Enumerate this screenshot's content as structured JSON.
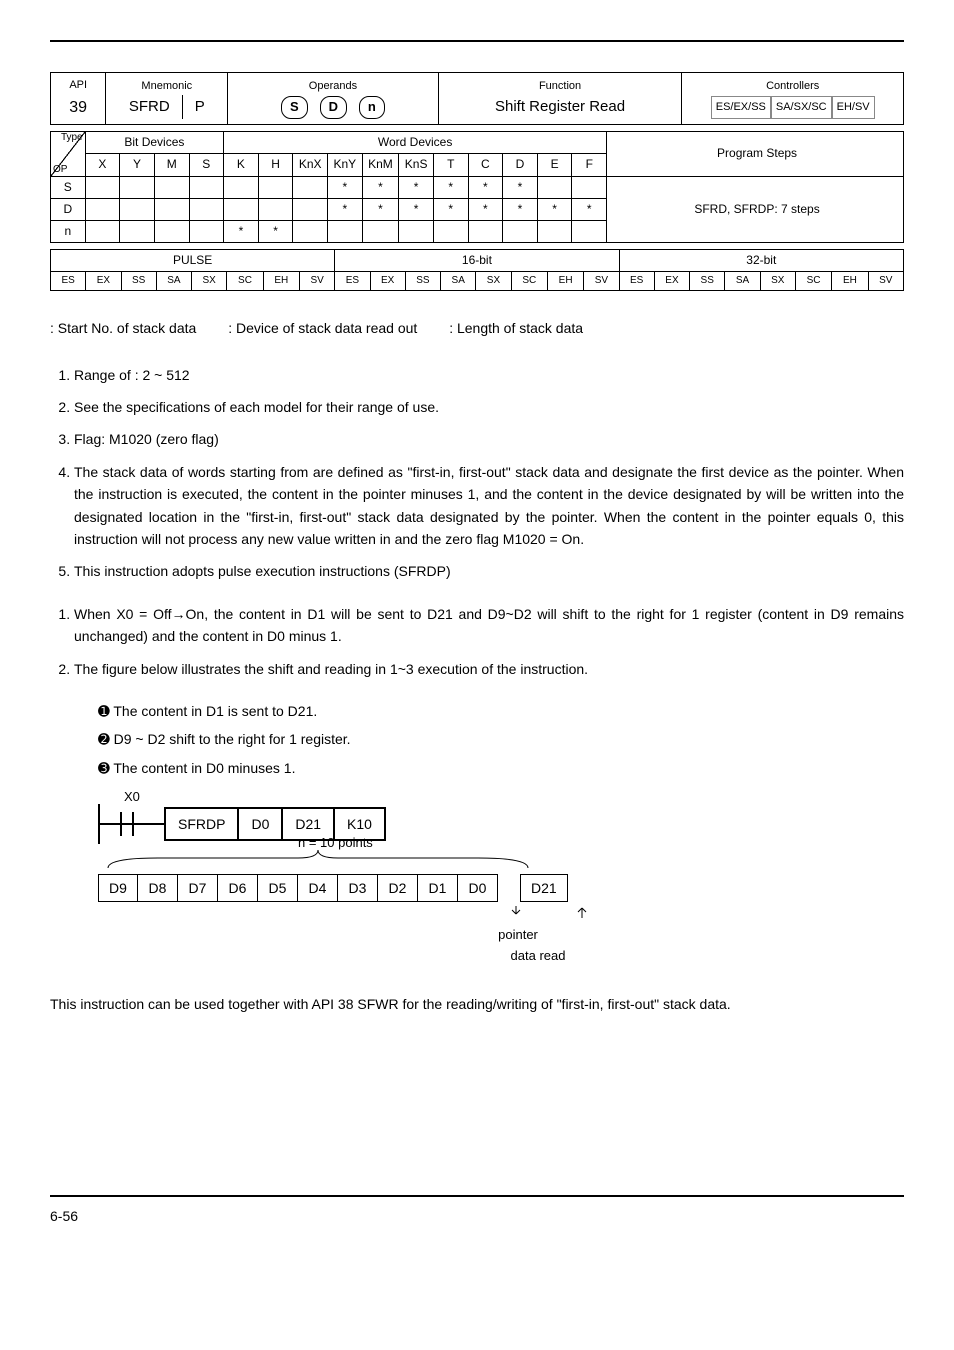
{
  "api": {
    "number": "39",
    "mnemonic": "SFRD",
    "p": "P",
    "operands_s": "S",
    "operands_d": "D",
    "operands_n": "n",
    "function": "Shift Register Read",
    "controllers": [
      "ES/EX/SS",
      "SA/SX/SC",
      "EH/SV"
    ],
    "type_label": "Type",
    "op_label": "OP",
    "cols": [
      "X",
      "Y",
      "M",
      "S",
      "K",
      "H",
      "KnX",
      "KnY",
      "KnM",
      "KnS",
      "T",
      "C",
      "D",
      "E",
      "F"
    ],
    "rows": [
      "S",
      "D",
      "n"
    ],
    "stars": {
      "S": [
        "",
        "",
        "",
        "",
        "",
        "",
        "",
        "*",
        "*",
        "*",
        "*",
        "*",
        "*",
        "",
        ""
      ],
      "D": [
        "",
        "",
        "",
        "",
        "",
        "",
        "",
        "*",
        "*",
        "*",
        "*",
        "*",
        "*",
        "*",
        "*"
      ],
      "n": [
        "",
        "",
        "",
        "",
        "*",
        "*",
        "",
        "",
        "",
        "",
        "",
        "",
        "",
        "",
        ""
      ]
    },
    "steps": "SFRD, SFRDP: 7 steps",
    "pulse_link": {
      "headers": [
        "PULSE",
        "16-bit",
        "32-bit"
      ],
      "cells": [
        "ES",
        "EX",
        "SS",
        "SA",
        "SX",
        "SC",
        "EH",
        "SV",
        "ES",
        "EX",
        "SS",
        "SA",
        "SX",
        "SC",
        "EH",
        "SV",
        "ES",
        "EX",
        "SS",
        "SA",
        "SX",
        "SC",
        "EH",
        "SV"
      ]
    }
  },
  "definitions": {
    "s": ": Start No. of stack data",
    "d": ": Device of stack data read out",
    "n": ": Length of stack data"
  },
  "explanations": [
    "Range of  : 2 ~ 512",
    "See the specifications of each model for their range of use.",
    "Flag: M1020 (zero flag)",
    "The stack data of   words starting from   are defined as \"first-in, first-out\" stack data and designate the first device as the pointer. When the instruction is executed, the content in the pointer minuses 1, and the content in the device designated by    will be written into the designated location in the \"first-in, first-out\" stack data designated by the pointer. When the content in the pointer equals 0, this instruction will not process any new value written in and the zero flag M1020 = On.",
    "This instruction adopts pulse execution instructions (SFRDP)"
  ],
  "program_example": [
    "When X0 = Off→On, the content in D1 will be sent to D21 and D9~D2 will shift to the right for 1 register (content in D9 remains unchanged) and the content in D0 minus 1.",
    "The figure below illustrates the shift and reading in 1~3 execution of the instruction."
  ],
  "sub_points": {
    "p1": "➊ The content in D1 is sent to D21.",
    "p2": "➋ D9 ~ D2 shift to the right for 1 register.",
    "p3": "➌ The content in D0 minuses 1."
  },
  "ladder": {
    "x_label": "X0",
    "inst": "SFRDP",
    "arg1": "D0",
    "arg2": "D21",
    "arg3": "K10",
    "n_label": "n = 10 points",
    "regs": [
      "D9",
      "D8",
      "D7",
      "D6",
      "D5",
      "D4",
      "D3",
      "D2",
      "D1",
      "D0"
    ],
    "out_reg": "D21",
    "pointer_lbl": "pointer",
    "data_read_lbl": "data read"
  },
  "remarks": "This instruction can be used together with API 38 SFWR for the reading/writing of \"first-in, first-out\" stack data.",
  "page_number": "6-56"
}
